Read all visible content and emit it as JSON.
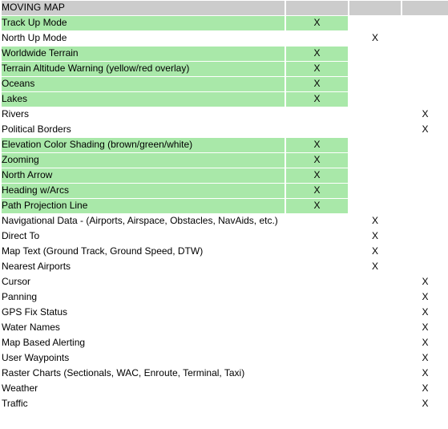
{
  "table": {
    "title": "MOVING MAP",
    "columns": [
      {
        "key": "feature",
        "label": "MOVING MAP"
      },
      {
        "key": "col2",
        "label": ""
      },
      {
        "key": "col3",
        "label": ""
      },
      {
        "key": "col4",
        "label": ""
      }
    ],
    "mark": "X",
    "colors": {
      "header_background": "#cccccc",
      "shaded_row_background": "#a9e8a9",
      "plain_row_background": "#ffffff",
      "text": "#000000"
    },
    "rows": [
      {
        "feature": "Track Up Mode",
        "shaded": true,
        "col2": "X",
        "col3": "",
        "col4": ""
      },
      {
        "feature": "North Up Mode",
        "shaded": false,
        "col2": "",
        "col3": "X",
        "col4": ""
      },
      {
        "feature": "Worldwide Terrain",
        "shaded": true,
        "col2": "X",
        "col3": "",
        "col4": ""
      },
      {
        "feature": "Terrain Altitude Warning (yellow/red overlay)",
        "shaded": true,
        "col2": "X",
        "col3": "",
        "col4": ""
      },
      {
        "feature": "Oceans",
        "shaded": true,
        "col2": "X",
        "col3": "",
        "col4": ""
      },
      {
        "feature": "Lakes",
        "shaded": true,
        "col2": "X",
        "col3": "",
        "col4": ""
      },
      {
        "feature": "Rivers",
        "shaded": false,
        "col2": "",
        "col3": "",
        "col4": "X"
      },
      {
        "feature": "Political Borders",
        "shaded": false,
        "col2": "",
        "col3": "",
        "col4": "X"
      },
      {
        "feature": "Elevation Color Shading (brown/green/white)",
        "shaded": true,
        "col2": "X",
        "col3": "",
        "col4": ""
      },
      {
        "feature": "Zooming",
        "shaded": true,
        "col2": "X",
        "col3": "",
        "col4": ""
      },
      {
        "feature": "North Arrow",
        "shaded": true,
        "col2": "X",
        "col3": "",
        "col4": ""
      },
      {
        "feature": "Heading w/Arcs",
        "shaded": true,
        "col2": "X",
        "col3": "",
        "col4": ""
      },
      {
        "feature": "Path Projection Line",
        "shaded": true,
        "col2": "X",
        "col3": "",
        "col4": ""
      },
      {
        "feature": "Navigational Data - (Airports, Airspace, Obstacles, NavAids, etc.)",
        "shaded": false,
        "col2": "",
        "col3": "X",
        "col4": "",
        "tall": true
      },
      {
        "feature": "Direct To",
        "shaded": false,
        "col2": "",
        "col3": "X",
        "col4": ""
      },
      {
        "feature": "Map Text (Ground Track, Ground Speed, DTW)",
        "shaded": false,
        "col2": "",
        "col3": "X",
        "col4": ""
      },
      {
        "feature": "Nearest Airports",
        "shaded": false,
        "col2": "",
        "col3": "X",
        "col4": ""
      },
      {
        "feature": "Cursor",
        "shaded": false,
        "col2": "",
        "col3": "",
        "col4": "X"
      },
      {
        "feature": "Panning",
        "shaded": false,
        "col2": "",
        "col3": "",
        "col4": "X"
      },
      {
        "feature": "GPS Fix Status",
        "shaded": false,
        "col2": "",
        "col3": "",
        "col4": "X"
      },
      {
        "feature": "Water Names",
        "shaded": false,
        "col2": "",
        "col3": "",
        "col4": "X"
      },
      {
        "feature": "Map Based Alerting",
        "shaded": false,
        "col2": "",
        "col3": "",
        "col4": "X"
      },
      {
        "feature": "User Waypoints",
        "shaded": false,
        "col2": "",
        "col3": "",
        "col4": "X"
      },
      {
        "feature": "Raster Charts (Sectionals, WAC, Enroute, Terminal, Taxi)",
        "shaded": false,
        "col2": "",
        "col3": "",
        "col4": "X"
      },
      {
        "feature": "Weather",
        "shaded": false,
        "col2": "",
        "col3": "",
        "col4": "X"
      },
      {
        "feature": "Traffic",
        "shaded": false,
        "col2": "",
        "col3": "",
        "col4": "X"
      }
    ]
  }
}
